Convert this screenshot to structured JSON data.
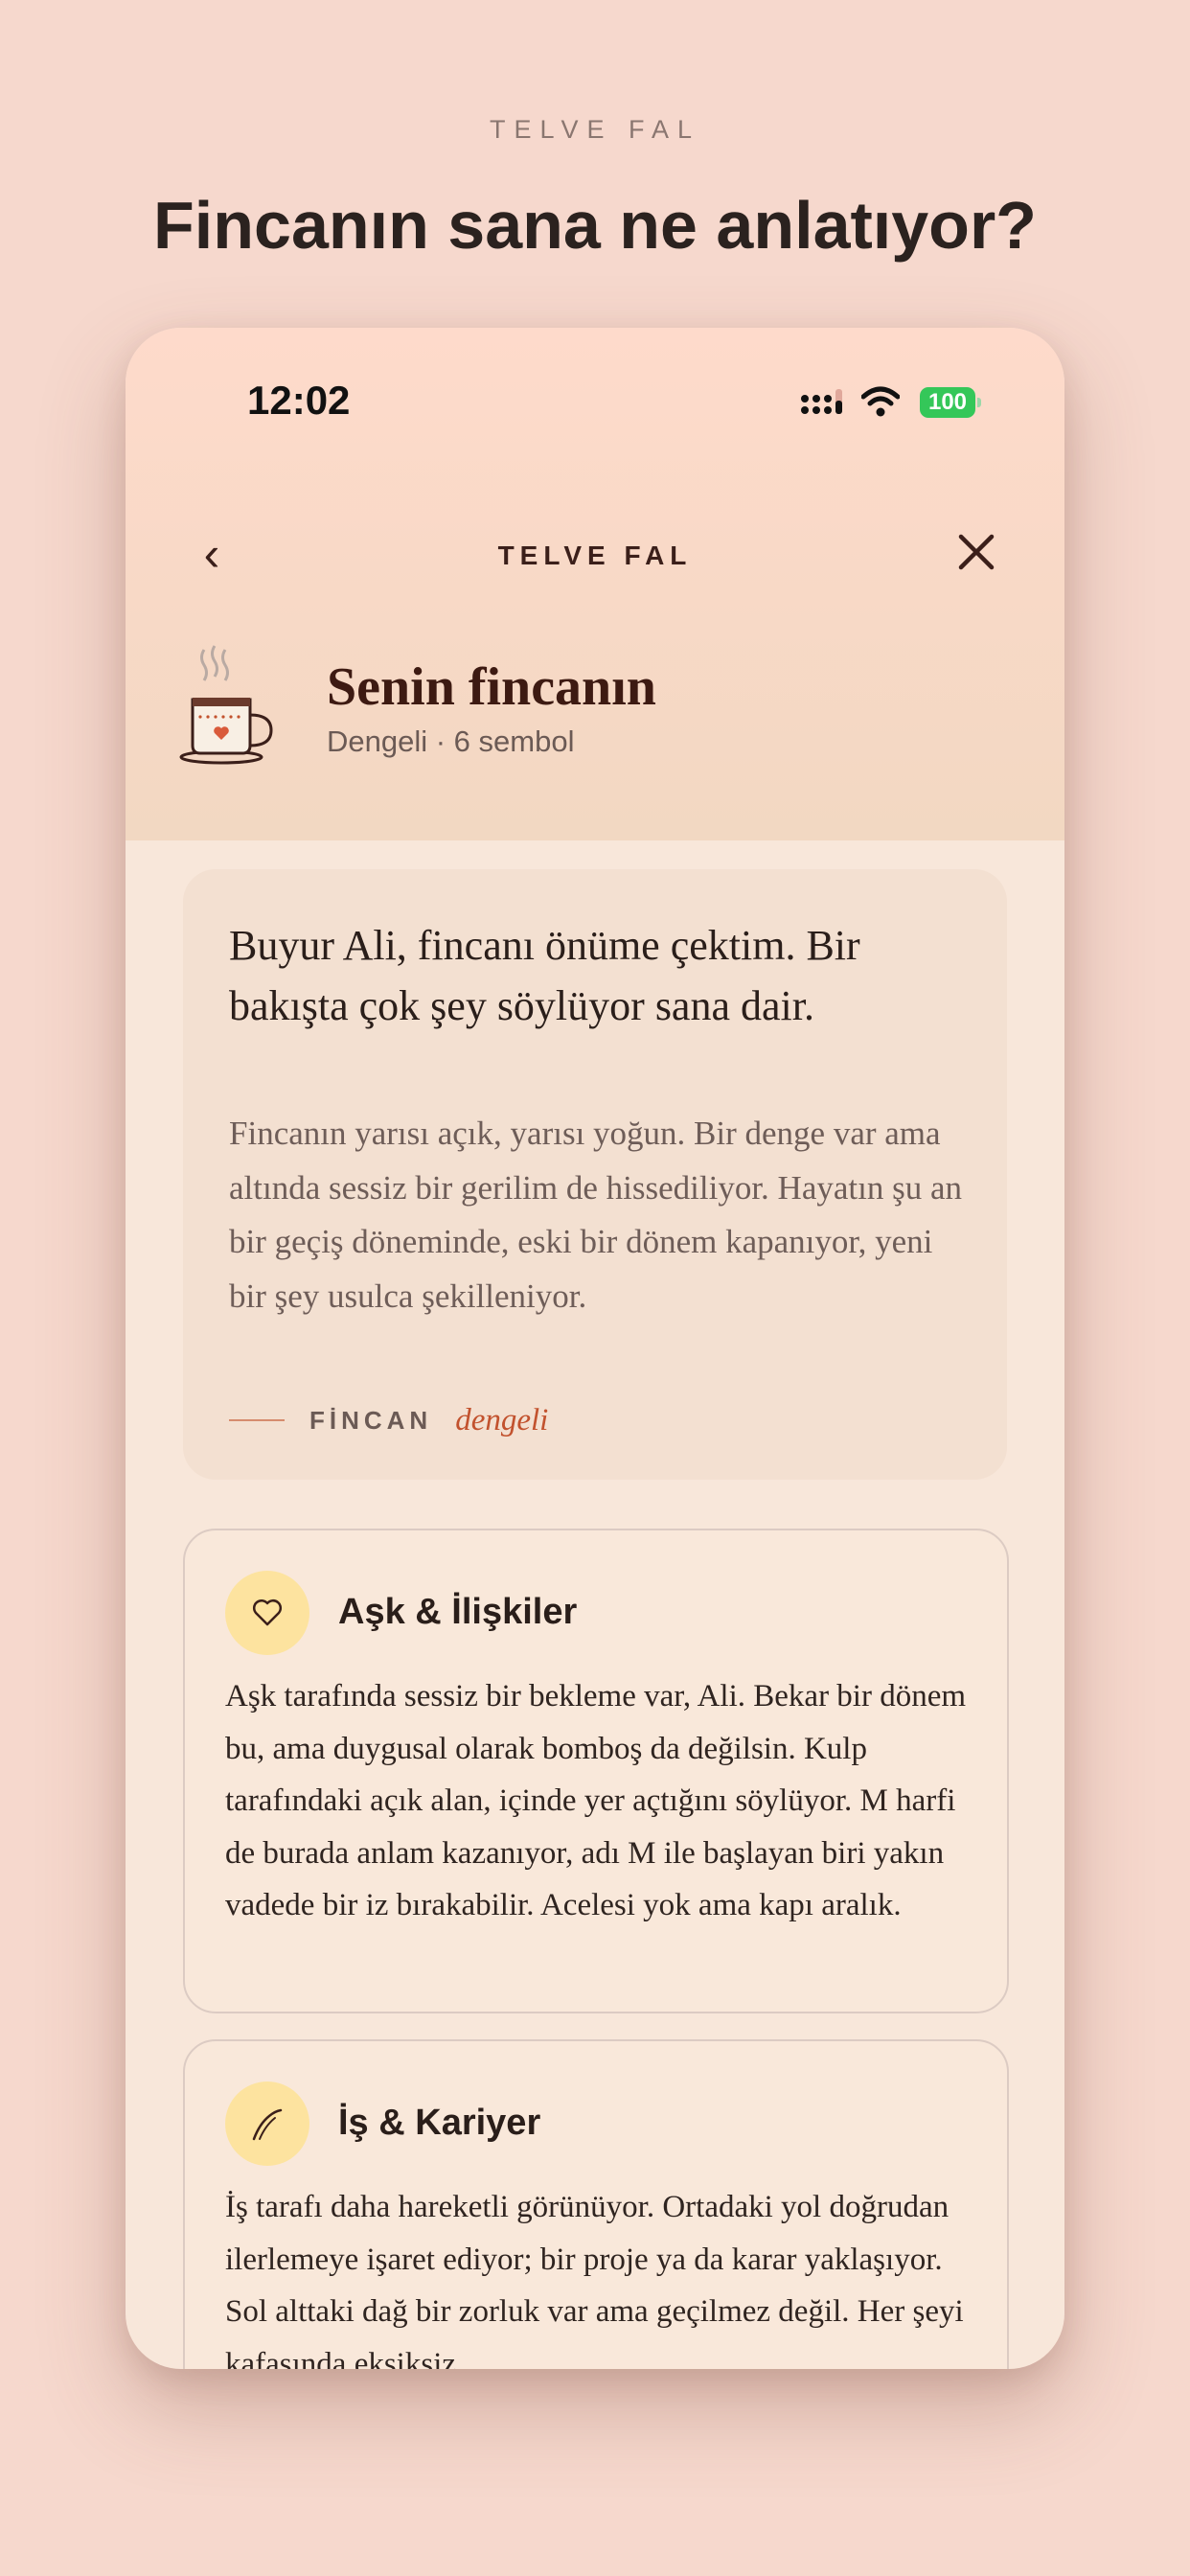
{
  "eyebrow": "TELVE FAL",
  "headline": "Fincanın sana ne anlatıyor?",
  "status": {
    "time": "12:02",
    "battery": "100"
  },
  "nav": {
    "title": "TELVE FAL"
  },
  "profile": {
    "title": "Senin fincanın",
    "subtitle": "Dengeli · 6 sembol"
  },
  "intro": {
    "heading": "Buyur Ali, fincanı önüme çektim. Bir bakışta çok şey söylüyor sana dair.",
    "body": "Fincanın yarısı açık, yarısı yoğun. Bir denge var ama altında sessiz bir gerilim de hissediliyor. Hayatın şu an bir geçiş döneminde, eski bir dönem kapanıyor, yeni bir şey usulca şekilleniyor.",
    "tag_label": "FİNCAN",
    "tag_value": "dengeli"
  },
  "sections": [
    {
      "icon": "heart-icon",
      "title": "Aşk & İlişkiler",
      "text": "Aşk tarafında sessiz bir bekleme var, Ali. Bekar bir dönem bu, ama duygusal olarak bomboş da değilsin. Kulp tarafındaki açık alan, içinde yer açtığını söylüyor. M harfi de burada anlam kazanıyor, adı M ile başlayan biri yakın vadede bir iz bırakabilir. Acelesi yok ama kapı aralık."
    },
    {
      "icon": "path-icon",
      "title": "İş & Kariyer",
      "text": "İş tarafı daha hareketli görünüyor. Ortadaki yol doğrudan ilerlemeye işaret ediyor; bir proje ya da karar yaklaşıyor. Sol alttaki dağ bir zorluk var ama geçilmez değil. Her şeyi kafasında eksiksiz"
    }
  ],
  "colors": {
    "background": "#f6d8cd",
    "header_top": "#fedacb",
    "accent": "#c2522e",
    "icon_bg": "#fde39f",
    "battery": "#34c759"
  }
}
